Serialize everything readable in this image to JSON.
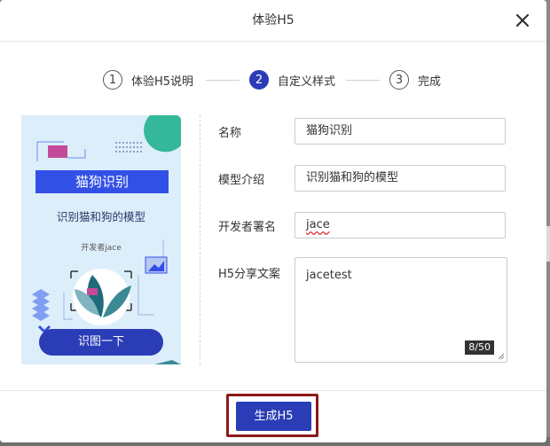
{
  "dialog": {
    "title": "体验H5"
  },
  "steps": [
    {
      "number": "1",
      "label": "体验H5说明",
      "active": false
    },
    {
      "number": "2",
      "label": "自定义样式",
      "active": true
    },
    {
      "number": "3",
      "label": "完成",
      "active": false
    }
  ],
  "preview": {
    "title": "猫狗识别",
    "description": "识别猫和狗的模型",
    "author": "开发者jace",
    "button": "识图一下"
  },
  "form": {
    "name_label": "名称",
    "name_value": "猫狗识别",
    "intro_label": "模型介绍",
    "intro_value": "识别猫和狗的模型",
    "signature_label": "开发者署名",
    "signature_value": "jace",
    "share_label": "H5分享文案",
    "share_value": "jacetest",
    "share_counter": "8/50"
  },
  "footer": {
    "generate_label": "生成H5"
  },
  "colors": {
    "primary": "#2a3db6",
    "highlight": "#8b1a1a",
    "preview_bg": "#ddeefb"
  }
}
